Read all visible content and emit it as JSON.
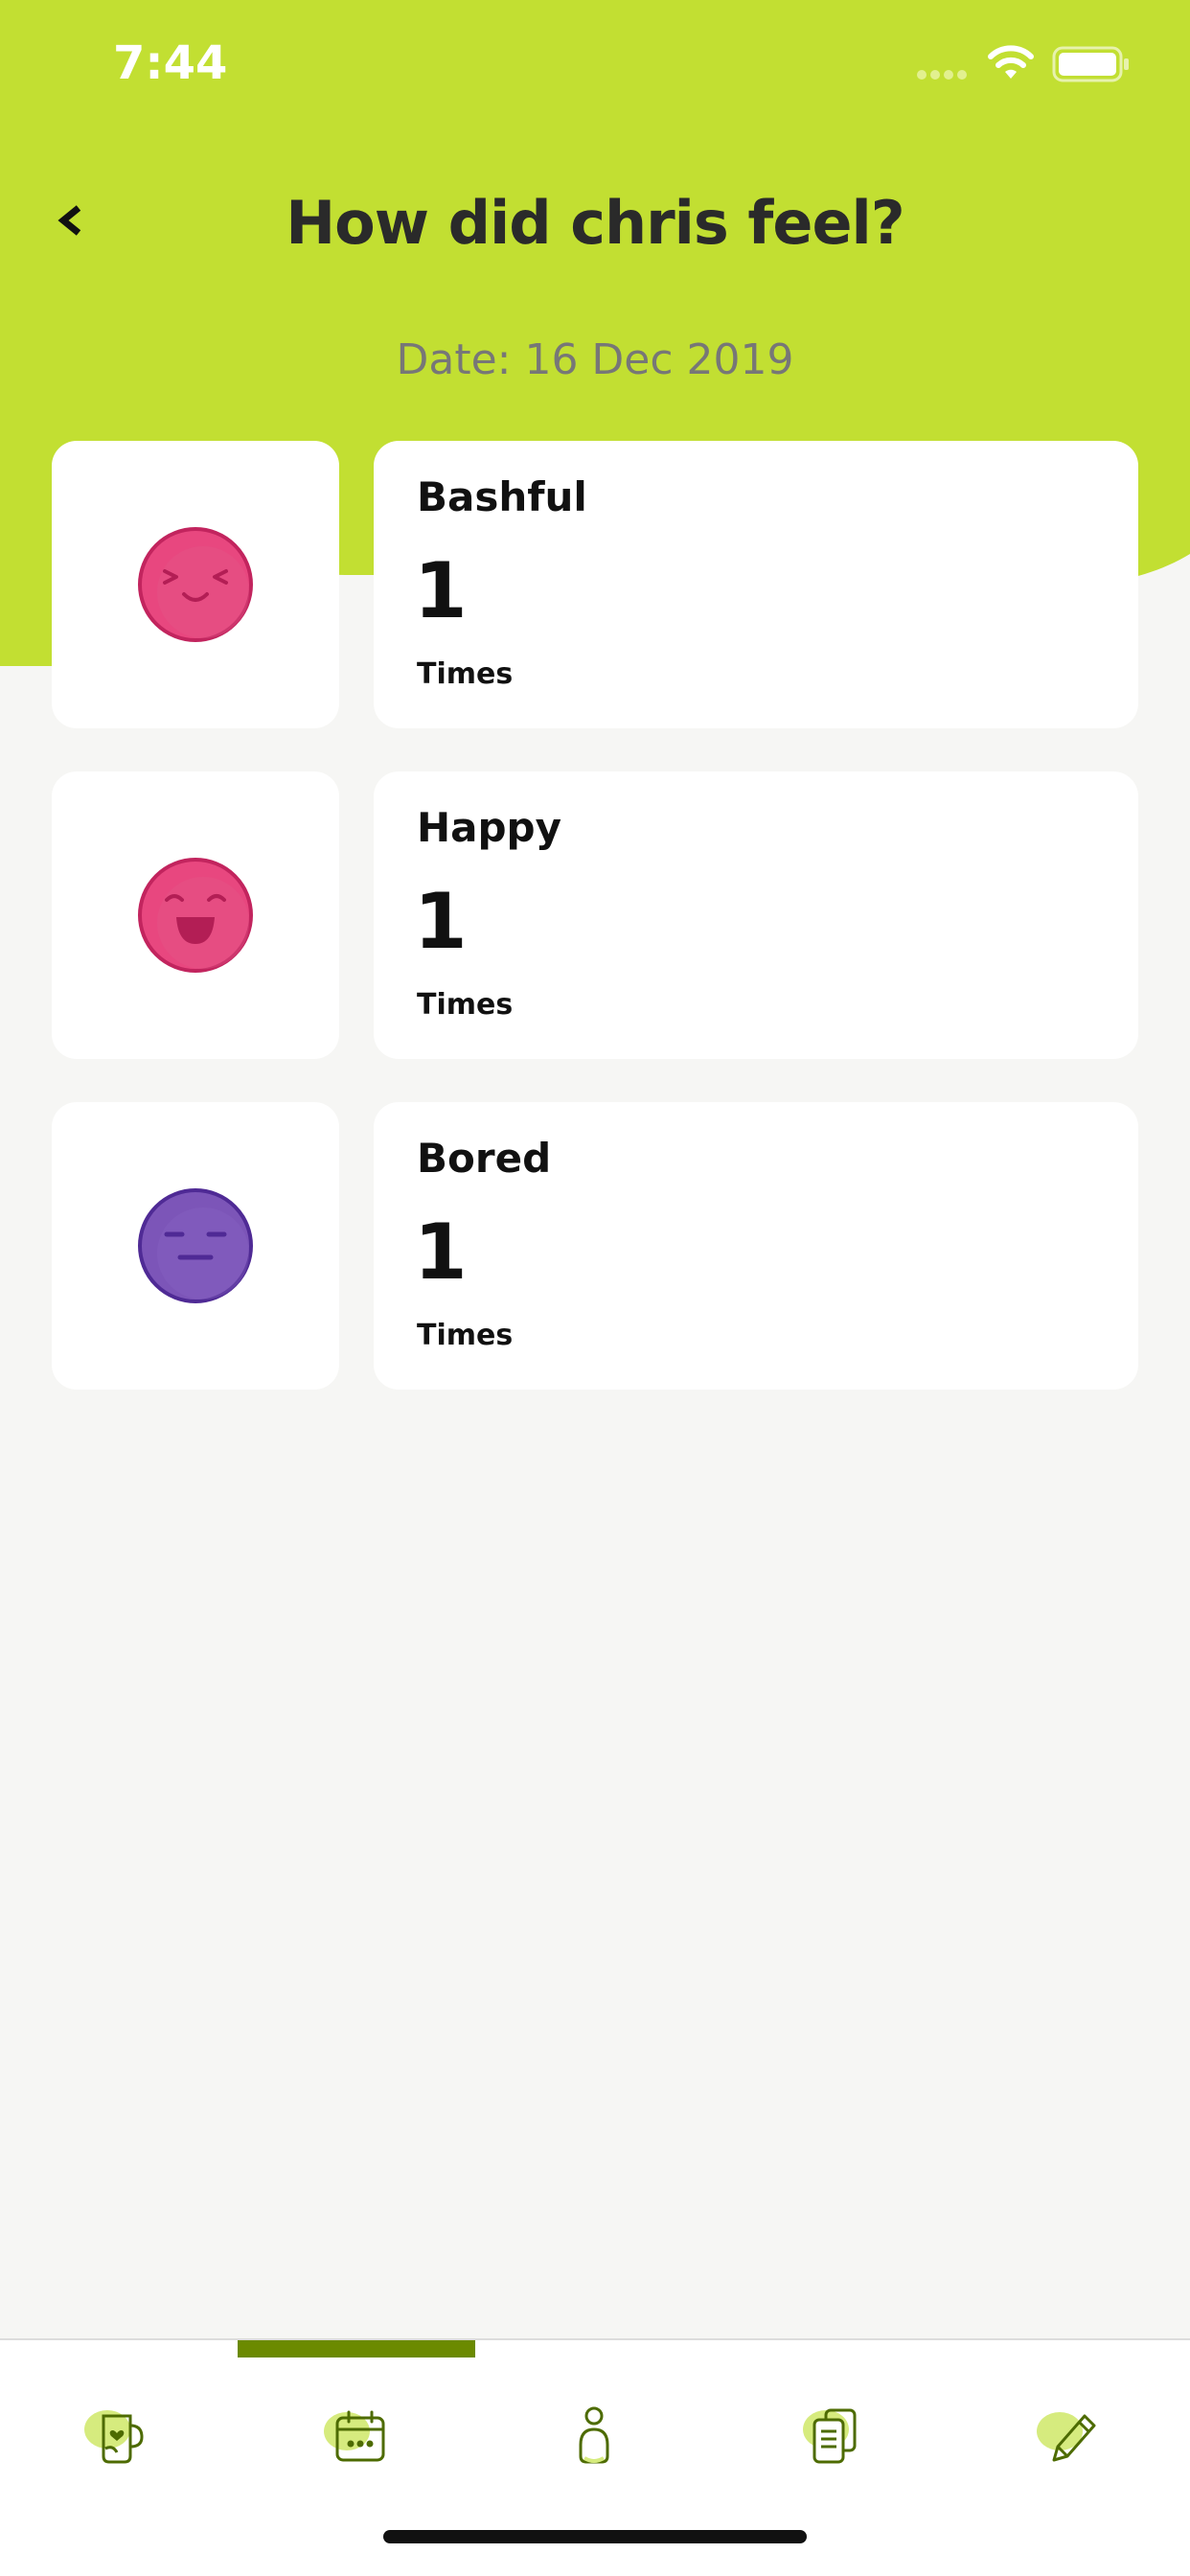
{
  "status": {
    "time": "7:44"
  },
  "header": {
    "title": "How did chris feel?",
    "date": "Date: 16 Dec 2019"
  },
  "emotions": [
    {
      "name": "Bashful",
      "count": "1",
      "unit": "Times",
      "icon": "bashful-face-icon",
      "color": "#e8477f"
    },
    {
      "name": "Happy",
      "count": "1",
      "unit": "Times",
      "icon": "happy-face-icon",
      "color": "#e8477f"
    },
    {
      "name": "Bored",
      "count": "1",
      "unit": "Times",
      "icon": "bored-face-icon",
      "color": "#7c55b8"
    }
  ],
  "tabs": [
    {
      "icon": "mug-heart-icon"
    },
    {
      "icon": "calendar-icon"
    },
    {
      "icon": "person-icon"
    },
    {
      "icon": "documents-icon"
    },
    {
      "icon": "pencil-icon"
    }
  ],
  "active_tab_index": 1,
  "colors": {
    "accent": "#c2df32",
    "tab_accent": "#6b8a00"
  }
}
